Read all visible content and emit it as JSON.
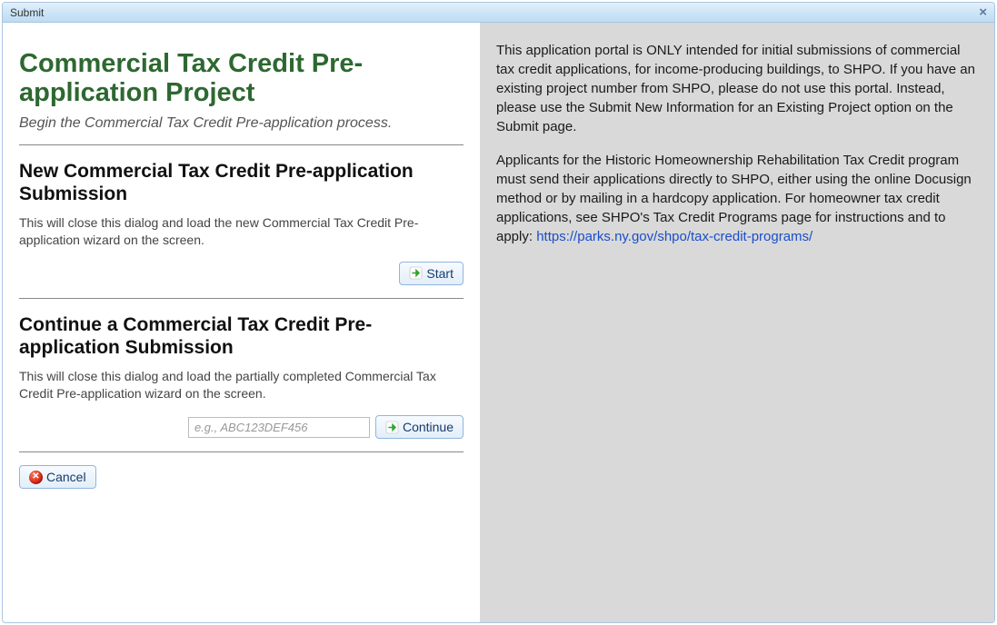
{
  "dialog": {
    "title": "Submit"
  },
  "main": {
    "heading": "Commercial Tax Credit Pre-application Project",
    "subtitle": "Begin the Commercial Tax Credit Pre-application process."
  },
  "newSubmission": {
    "heading": "New Commercial Tax Credit Pre-application Submission",
    "description": "This will close this dialog and load the new Commercial Tax Credit Pre-application wizard on the screen.",
    "startLabel": "Start"
  },
  "continueSubmission": {
    "heading": "Continue a Commercial Tax Credit Pre-application Submission",
    "description": "This will close this dialog and load the partially completed Commercial Tax Credit Pre-application wizard on the screen.",
    "placeholder": "e.g., ABC123DEF456",
    "continueLabel": "Continue"
  },
  "footer": {
    "cancelLabel": "Cancel"
  },
  "info": {
    "para1": "This application portal is ONLY intended for initial submissions of commercial tax credit applications, for income-producing buildings, to SHPO. If you have an existing project number from SHPO, please do not use this portal. Instead, please use the Submit New Information for an Existing Project option on the Submit page.",
    "para2a": "Applicants for the Historic Homeownership Rehabilitation Tax Credit program must send their applications directly to SHPO, either using the online Docusign method or by mailing in a hardcopy application. For homeowner tax credit applications, see SHPO's Tax Credit Programs page for instructions and to apply: ",
    "link": "https://parks.ny.gov/shpo/tax-credit-programs/"
  }
}
